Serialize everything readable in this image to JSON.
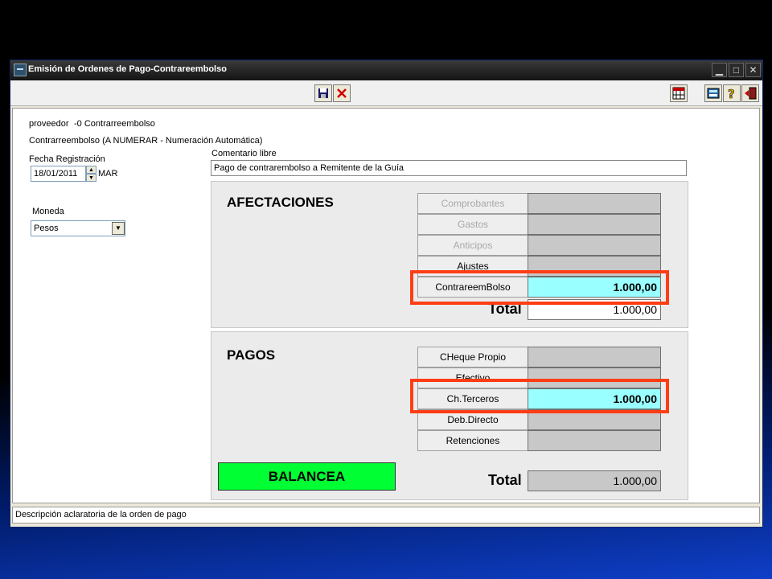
{
  "window": {
    "title": "Emisión de Ordenes de Pago-Contrareembolso",
    "controls": {
      "minimize": "▁",
      "maximize": "□",
      "close": "✕"
    }
  },
  "toolbar": {
    "save_icon": "floppy-disk",
    "cancel_icon": "red-x",
    "calendar_icon": "calendar-grid",
    "calculator_icon": "calculator",
    "help_icon": "question-mark",
    "exit_icon": "exit-door"
  },
  "form": {
    "proveedor_label": "proveedor",
    "proveedor_value": "-0 Contrarreembolso",
    "type_line": "Contrarreembolso (A NUMERAR - Numeración Automática)",
    "fecha_label": "Fecha Registración",
    "fecha_value": "18/01/2011",
    "fecha_day": "MAR",
    "comentario_label": "Comentario libre",
    "comentario_value": "Pago de contrarembolso a Remitente de la Guía",
    "moneda_label": "Moneda",
    "moneda_value": "Pesos"
  },
  "afectaciones": {
    "title": "AFECTACIONES",
    "rows": [
      {
        "label": "Comprobantes",
        "value": "",
        "disabled": true,
        "active": false
      },
      {
        "label": "Gastos",
        "value": "",
        "disabled": true,
        "active": false
      },
      {
        "label": "Anticipos",
        "value": "",
        "disabled": true,
        "active": false
      },
      {
        "label": "Ajustes",
        "value": "",
        "disabled": false,
        "active": false
      },
      {
        "label": "ContrareemBolso",
        "value": "1.000,00",
        "disabled": false,
        "active": true
      }
    ],
    "total_label": "Total",
    "total_value": "1.000,00"
  },
  "pagos": {
    "title": "PAGOS",
    "rows": [
      {
        "label": "CHeque Propio",
        "value": "",
        "disabled": false,
        "active": false
      },
      {
        "label": "Efectivo",
        "value": "",
        "disabled": false,
        "active": false
      },
      {
        "label": "Ch.Terceros",
        "value": "1.000,00",
        "disabled": false,
        "active": true
      },
      {
        "label": "Deb.Directo",
        "value": "",
        "disabled": false,
        "active": false
      },
      {
        "label": "Retenciones",
        "value": "",
        "disabled": false,
        "active": false
      }
    ],
    "total_label": "Total",
    "total_value": "1.000,00"
  },
  "balance_label": "BALANCEA",
  "status_text": "Descripción aclaratoria de la orden de pago",
  "colors": {
    "active_value": "#99ffff",
    "balance": "#00ff33",
    "highlight": "#ff3d14"
  }
}
